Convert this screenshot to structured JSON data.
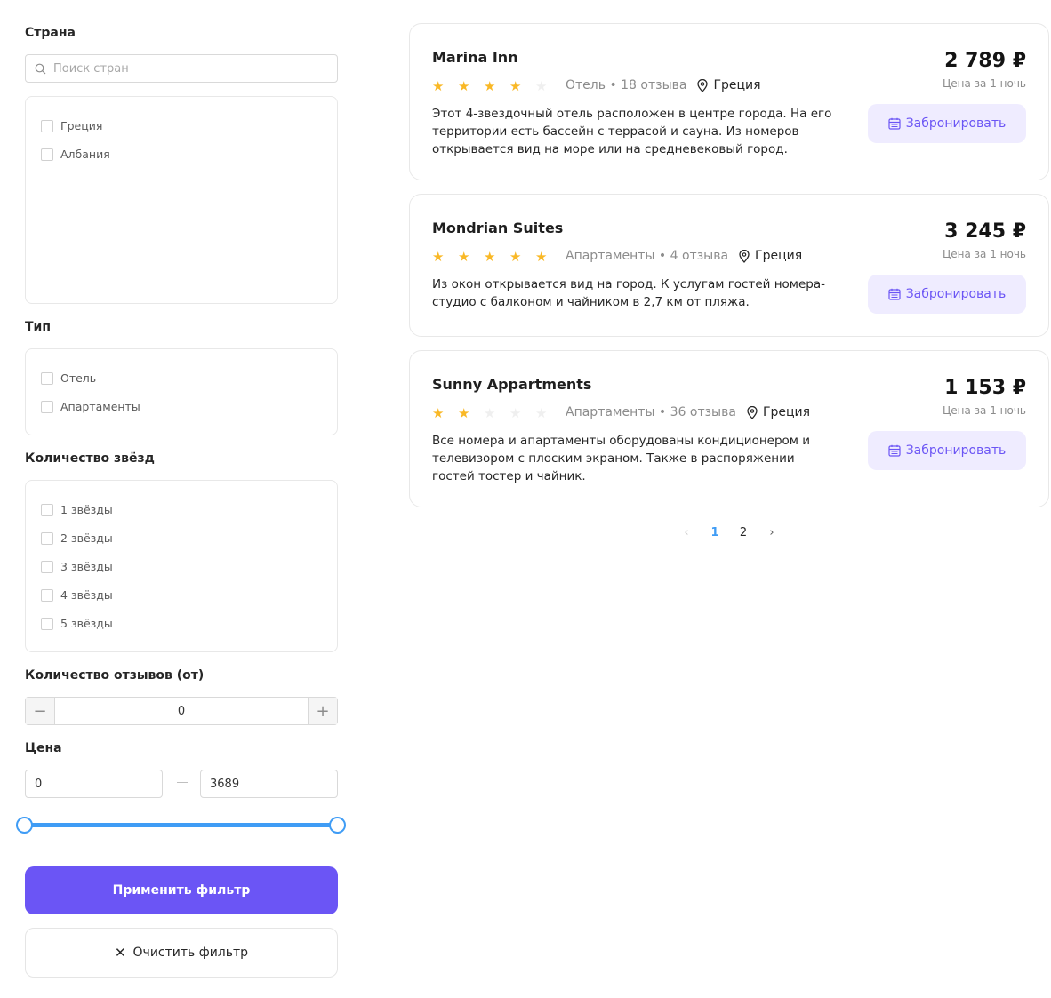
{
  "filters": {
    "country": {
      "title": "Страна",
      "search_placeholder": "Поиск стран",
      "options": [
        "Греция",
        "Албания"
      ]
    },
    "type": {
      "title": "Тип",
      "options": [
        "Отель",
        "Апартаменты"
      ]
    },
    "stars": {
      "title": "Количество звёзд",
      "options": [
        "1 звёзды",
        "2 звёзды",
        "3 звёзды",
        "4 звёзды",
        "5 звёзды"
      ]
    },
    "reviews": {
      "title": "Количество отзывов (от)",
      "value": "0",
      "minus": "−",
      "plus": "+"
    },
    "price": {
      "title": "Цена",
      "min": "0",
      "max": "3689",
      "range_fraction": [
        0,
        1
      ]
    },
    "apply_label": "Применить фильтр",
    "clear_label": "Очистить фильтр"
  },
  "hotels": [
    {
      "name": "Marina Inn",
      "stars": 4,
      "type_reviews": "Отель • 18 отзыва",
      "location": "Греция",
      "description": "Этот 4-звездочный отель расположен в центре города. На его территории есть бассейн с террасой и сауна. Из номеров открывается вид на море или на средневековый город.",
      "price": "2 789 ₽",
      "price_note": "Цена за 1 ночь",
      "book_label": "Забронировать"
    },
    {
      "name": "Mondrian Suites",
      "stars": 5,
      "type_reviews": "Апартаменты • 4 отзыва",
      "location": "Греция",
      "description": "Из окон открывается вид на город. К услугам гостей номера-студио с балконом и чайником в 2,7 км от пляжа.",
      "price": "3 245 ₽",
      "price_note": "Цена за 1 ночь",
      "book_label": "Забронировать"
    },
    {
      "name": "Sunny Appartments",
      "stars": 2,
      "type_reviews": "Апартаменты • 36 отзыва",
      "location": "Греция",
      "description": "Все номера и апартаменты оборудованы кондиционером и телевизором с плоским экраном. Также в распоряжении гостей тостер и чайник.",
      "price": "1 153 ₽",
      "price_note": "Цена за 1 ночь",
      "book_label": "Забронировать"
    }
  ],
  "pagination": {
    "prev": "‹",
    "pages": [
      "1",
      "2"
    ],
    "current": "1",
    "next": "›"
  },
  "colors": {
    "accent": "#6b55f5",
    "accent_light": "#efecff",
    "star": "#f9b826",
    "slider": "#3f9cf5",
    "active_page": "#3f9cf5"
  }
}
